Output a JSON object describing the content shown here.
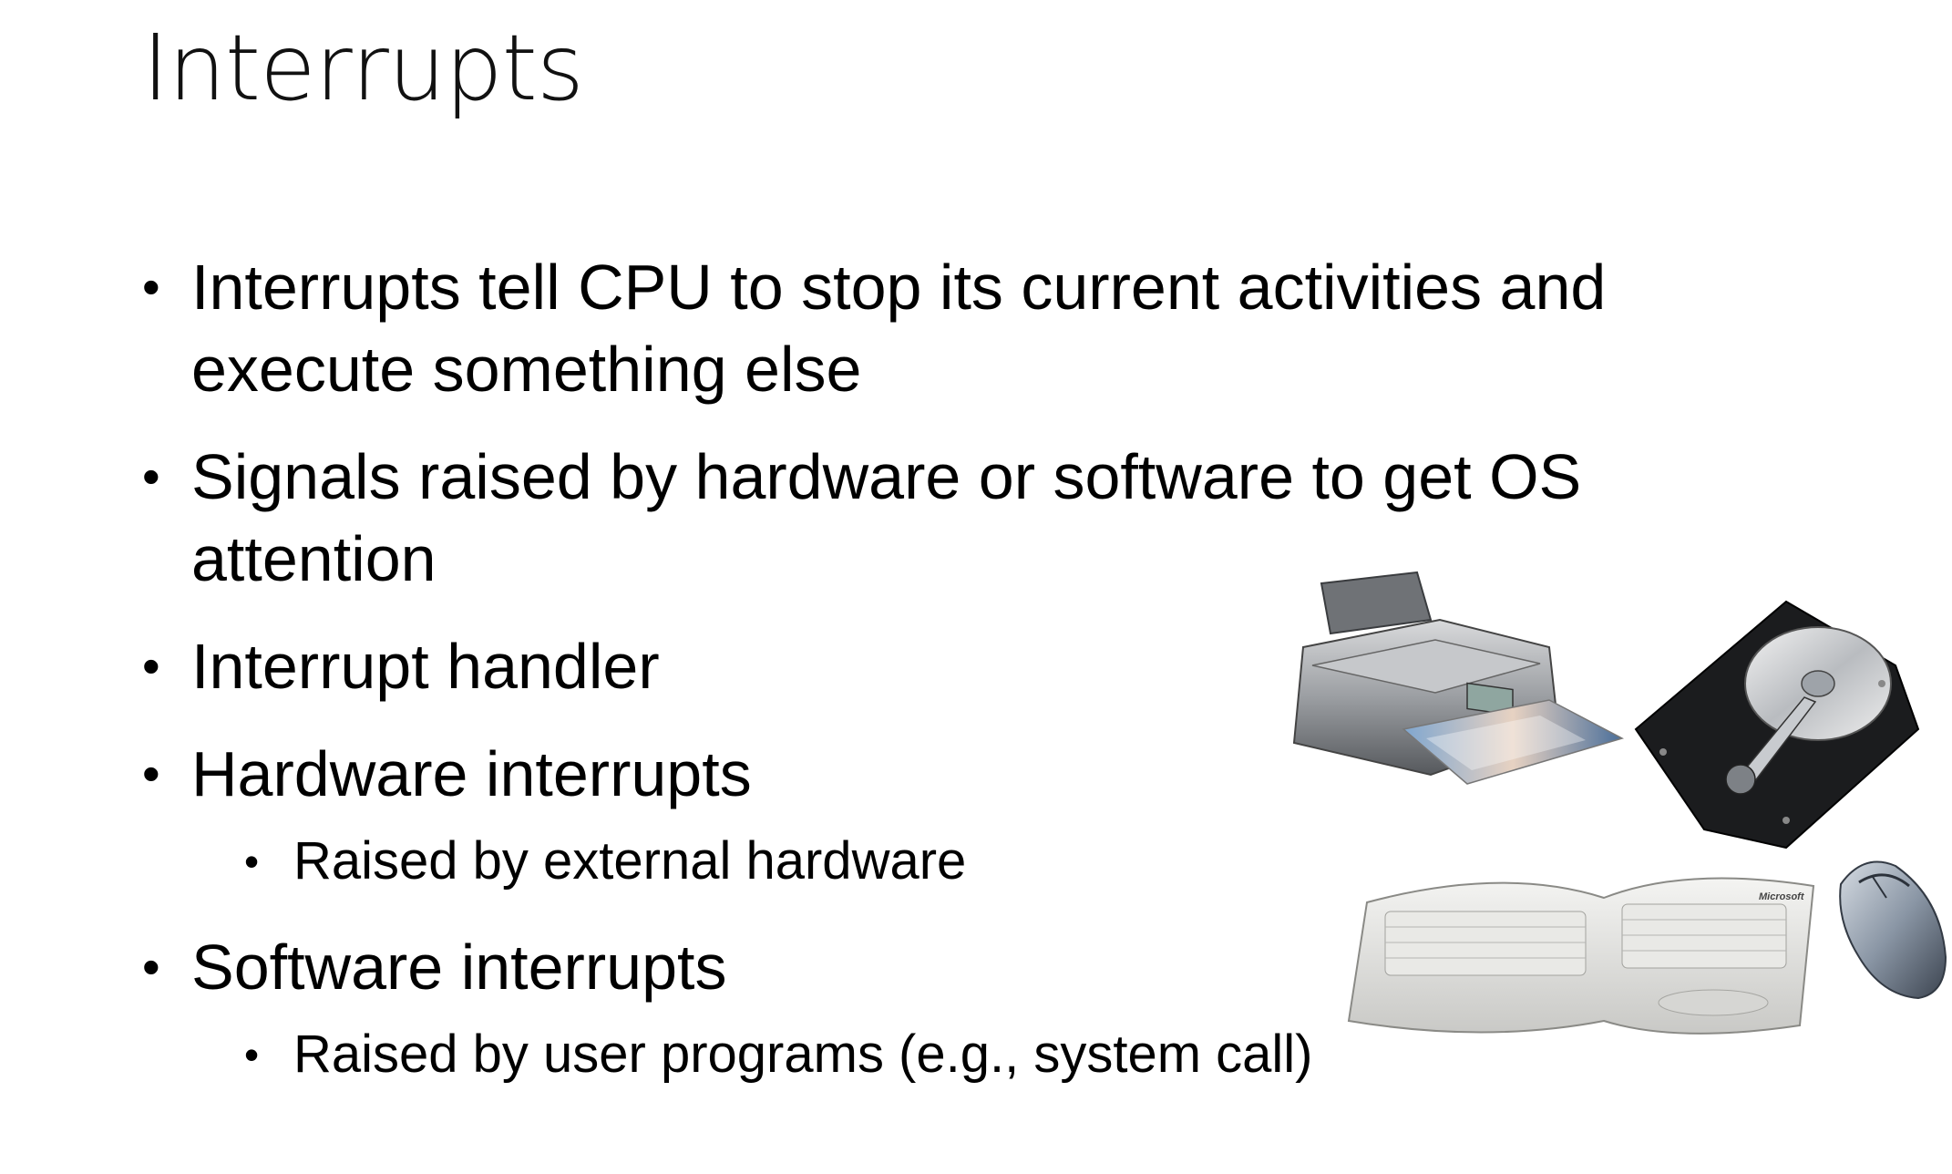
{
  "slide": {
    "title": "Interrupts",
    "bullets": [
      {
        "text": "Interrupts tell CPU to stop its current activities and",
        "cont": "execute something else"
      },
      {
        "text": "Signals raised by hardware or software to get OS",
        "cont": "attention"
      },
      {
        "text": "Interrupt handler"
      },
      {
        "text": "Hardware interrupts",
        "sub": "Raised by external hardware"
      },
      {
        "text": "Software interrupts",
        "sub": "Raised by user programs (e.g., system call)"
      }
    ],
    "bullet_glyph": "•"
  },
  "illustration": {
    "icons": [
      "printer-icon",
      "hard-drive-icon",
      "keyboard-icon",
      "mouse-icon"
    ],
    "keyboard_brand": "Microsoft"
  }
}
